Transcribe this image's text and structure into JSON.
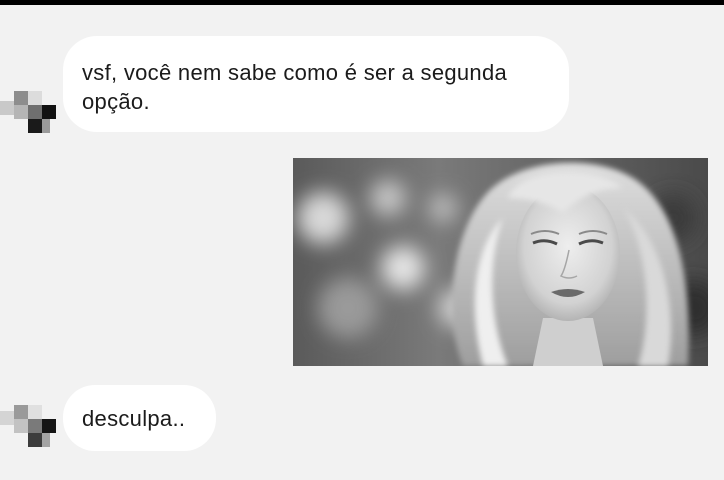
{
  "messages": [
    {
      "from": "contact",
      "text": "vsf, você nem sabe como é ser a segunda opção."
    },
    {
      "from": "me",
      "type": "image",
      "description": ""
    },
    {
      "from": "contact",
      "text": "desculpa.."
    }
  ],
  "colors": {
    "background": "#f2f2f2",
    "bubble": "#ffffff",
    "text": "#1b1b1b",
    "top_bar": "#000000"
  },
  "icons": {
    "avatar": "pixelated-avatar"
  }
}
